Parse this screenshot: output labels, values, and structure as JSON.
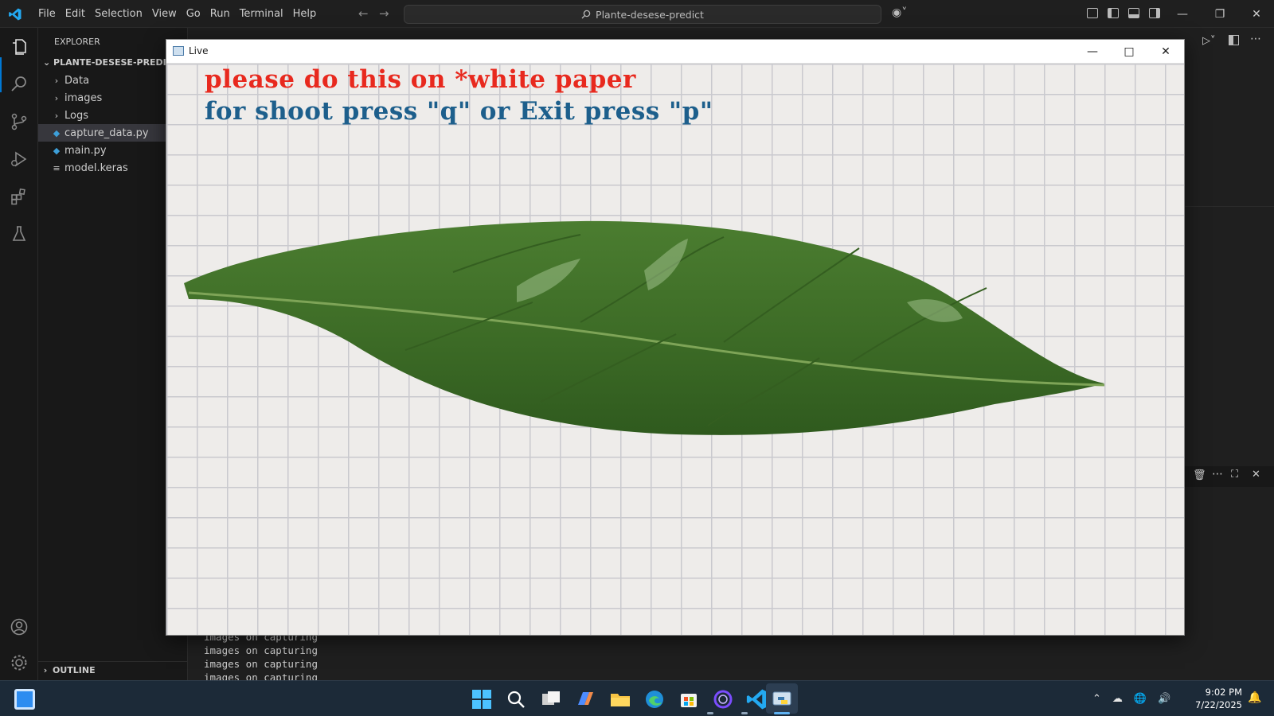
{
  "menubar": {
    "items": [
      "File",
      "Edit",
      "Selection",
      "View",
      "Go",
      "Run",
      "Terminal",
      "Help"
    ]
  },
  "command_center": {
    "text": "Plante-desese-predict"
  },
  "sidebar": {
    "title": "EXPLORER",
    "workspace": "PLANTE-DESESE-PREDICT",
    "items": [
      {
        "label": "Data",
        "kind": "folder"
      },
      {
        "label": "images",
        "kind": "folder"
      },
      {
        "label": "Logs",
        "kind": "folder"
      },
      {
        "label": "capture_data.py",
        "kind": "python",
        "selected": true
      },
      {
        "label": "main.py",
        "kind": "python"
      },
      {
        "label": "model.keras",
        "kind": "file"
      }
    ],
    "outline": "OUTLINE"
  },
  "terminal": {
    "lines": [
      "images on capturing",
      "images on capturing",
      "images on capturing",
      "images on capturing"
    ]
  },
  "live_window": {
    "title": "Live",
    "overlay_line_1": "please do this on *white paper",
    "overlay_line_2": "for shoot press \"q\" or Exit press \"p\""
  },
  "taskbar": {
    "icons": [
      "windows-start-icon",
      "search-icon",
      "task-view-icon",
      "copilot-icon",
      "file-explorer-icon",
      "edge-icon",
      "store-icon",
      "cortana-icon",
      "vscode-icon",
      "python-icon"
    ],
    "clock_time": "9:02 PM",
    "clock_date": "7/22/2025"
  },
  "colors": {
    "accent": "#0078d4",
    "overlay_red": "#e8291e",
    "overlay_blue": "#1d5f8c",
    "leaf_green": "#3f6e28"
  }
}
